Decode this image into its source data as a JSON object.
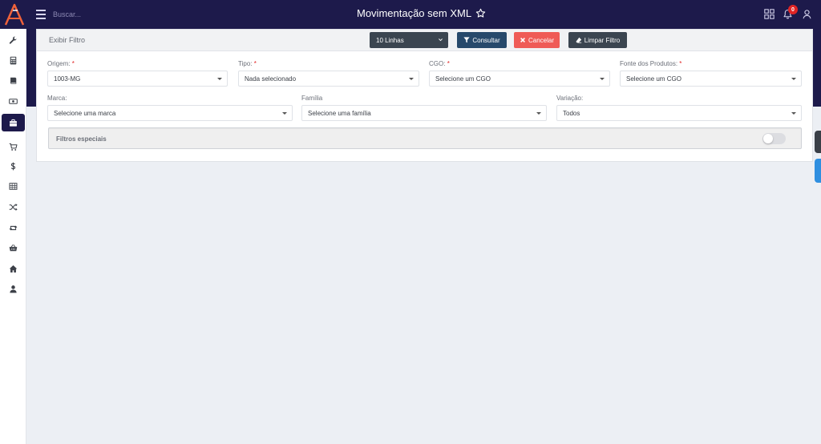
{
  "app": {
    "title": "Movimentação sem XML",
    "search_placeholder": "Buscar...",
    "notification_count": "0",
    "accent": "#1d1a4b",
    "logo_color": "#f0623a"
  },
  "sidebar": {
    "items": [
      {
        "icon": "wrench-icon"
      },
      {
        "icon": "calculator-icon"
      },
      {
        "icon": "book-icon"
      },
      {
        "icon": "money-icon"
      },
      {
        "icon": "briefcase-icon",
        "active": true
      },
      {
        "icon": "cart-icon"
      },
      {
        "icon": "dollar-icon"
      },
      {
        "icon": "table-icon"
      },
      {
        "icon": "shuffle-icon"
      },
      {
        "icon": "retweet-icon"
      },
      {
        "icon": "basket-icon"
      },
      {
        "icon": "home-icon"
      },
      {
        "icon": "user-icon"
      }
    ]
  },
  "filter_panel": {
    "header": "Exibir Filtro",
    "lines_select": "10 Linhas",
    "buttons": {
      "consultar": "Consultar",
      "cancelar": "Cancelar",
      "limpar": "Limpar Filtro"
    },
    "fields": {
      "origem": {
        "label": "Origem:",
        "required": "*",
        "value": "1003-MG"
      },
      "tipo": {
        "label": "Tipo:",
        "required": "*",
        "value": "Nada selecionado"
      },
      "cgo": {
        "label": "CGO:",
        "required": "*",
        "value": "Selecione um CGO"
      },
      "fonte": {
        "label": "Fonte dos Produtos:",
        "required": "*",
        "value": "Selecione um CGO"
      },
      "marca": {
        "label": "Marca:",
        "value": "Selecione uma marca"
      },
      "familia": {
        "label": "Família",
        "value": "Selecione uma família"
      },
      "variacao": {
        "label": "Variação:",
        "value": "Todos"
      }
    },
    "special": {
      "label": "Filtros especiais",
      "toggle_on": false
    }
  }
}
